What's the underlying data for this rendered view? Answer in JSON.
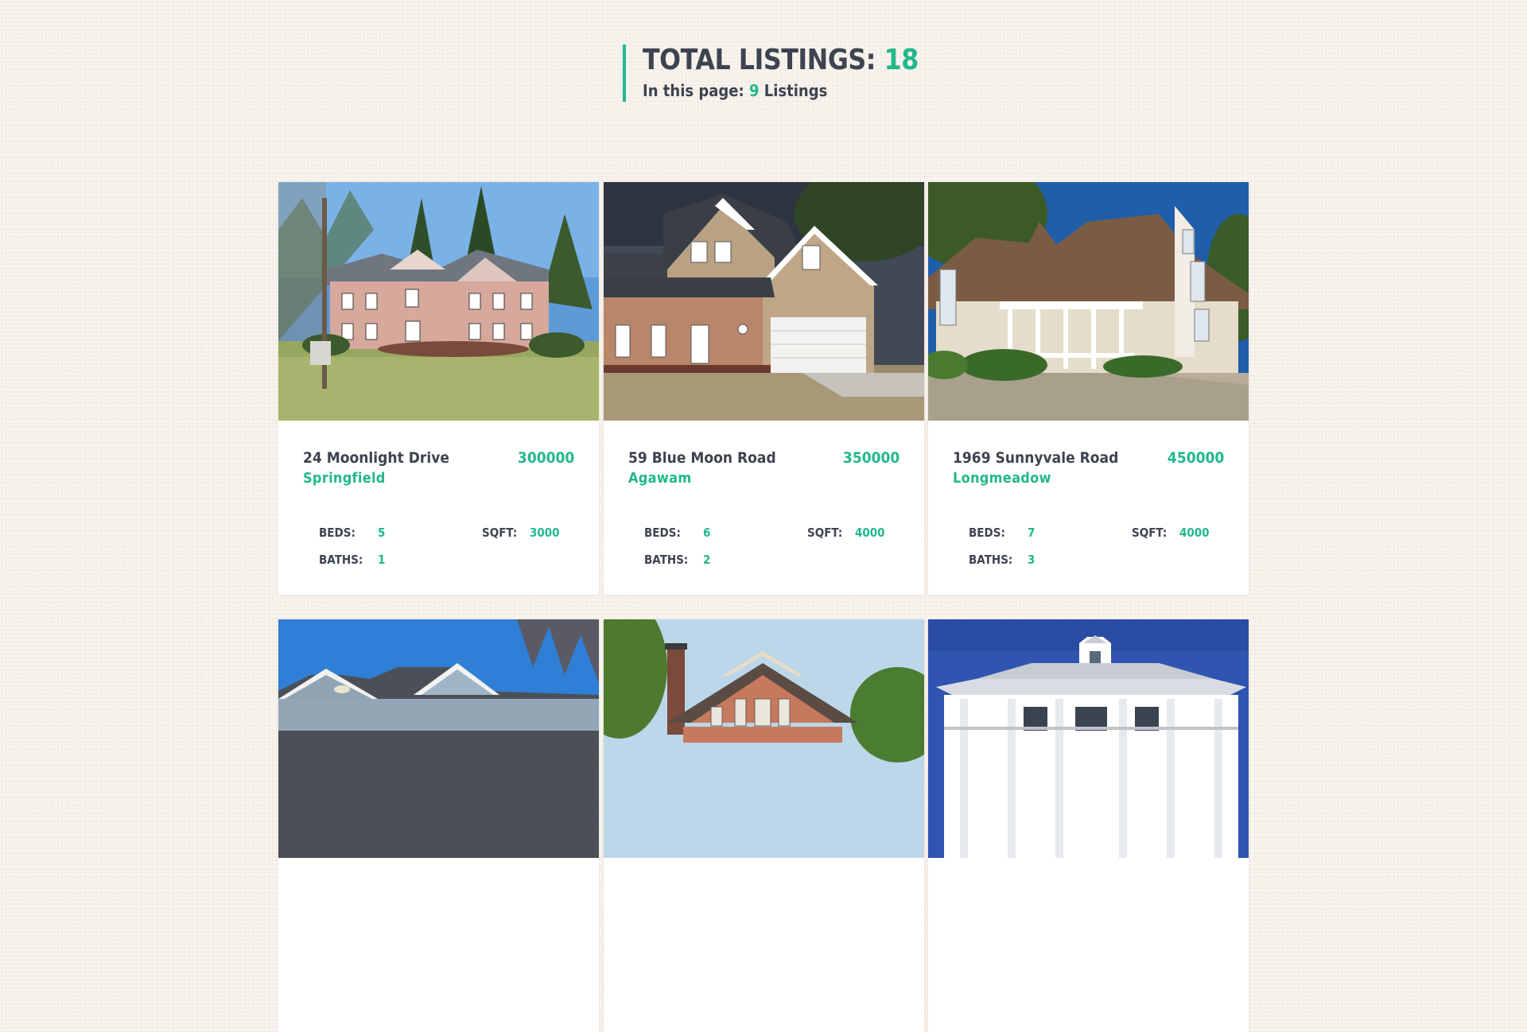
{
  "header": {
    "total_label": "TOTAL LISTINGS:",
    "total_count": "18",
    "page_prefix": "In this page:",
    "page_count": "9",
    "page_suffix": "Listings"
  },
  "labels": {
    "beds": "BEDS:",
    "baths": "BATHS:",
    "sqft": "SQFT:"
  },
  "listings": [
    {
      "address": "24 Moonlight Drive",
      "price": "300000",
      "city": "Springfield",
      "beds": "5",
      "baths": "1",
      "sqft": "3000",
      "photo": "brick-house-photo"
    },
    {
      "address": "59 Blue Moon Road",
      "price": "350000",
      "city": "Agawam",
      "beds": "6",
      "baths": "2",
      "sqft": "4000",
      "photo": "tan-house-photo"
    },
    {
      "address": "1969 Sunnyvale Road",
      "price": "450000",
      "city": "Longmeadow",
      "beds": "7",
      "baths": "3",
      "sqft": "4000",
      "photo": "victorian-house-photo"
    },
    {
      "photo": "blue-house-photo"
    },
    {
      "photo": "craftsman-house-photo"
    },
    {
      "photo": "beach-house-photo"
    }
  ],
  "colors": {
    "accent": "#22b88c",
    "text": "#3d4450",
    "background": "#f8f2ec",
    "card": "#ffffff"
  }
}
